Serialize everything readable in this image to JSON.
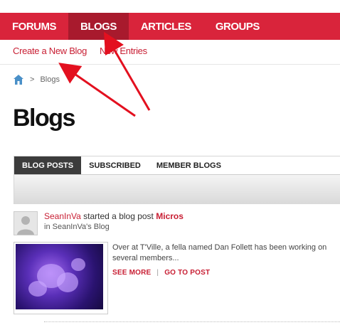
{
  "topnav": {
    "items": [
      {
        "label": "FORUMS"
      },
      {
        "label": "BLOGS"
      },
      {
        "label": "ARTICLES"
      },
      {
        "label": "GROUPS"
      }
    ]
  },
  "subnav": {
    "create_label": "Create a New Blog",
    "new_entries_label": "New Entries"
  },
  "breadcrumb": {
    "current": "Blogs",
    "separator": ">"
  },
  "page_title": "Blogs",
  "tabs": [
    {
      "label": "BLOG POSTS"
    },
    {
      "label": "SUBSCRIBED"
    },
    {
      "label": "MEMBER BLOGS"
    }
  ],
  "entry": {
    "user": "SeanInVa",
    "action": " started a blog post ",
    "post_title": "Micros",
    "location": "in SeanInVa's Blog",
    "excerpt": "Over at T'Ville, a fella named Dan Follett has been working on several members...",
    "see_more": "SEE MORE",
    "separator": "|",
    "go_to_post": "GO TO POST"
  },
  "colors": {
    "brand_red": "#d9243b",
    "active_nav": "#a81a2d",
    "link_red": "#c81e33",
    "arrow_red": "#e3101f"
  }
}
